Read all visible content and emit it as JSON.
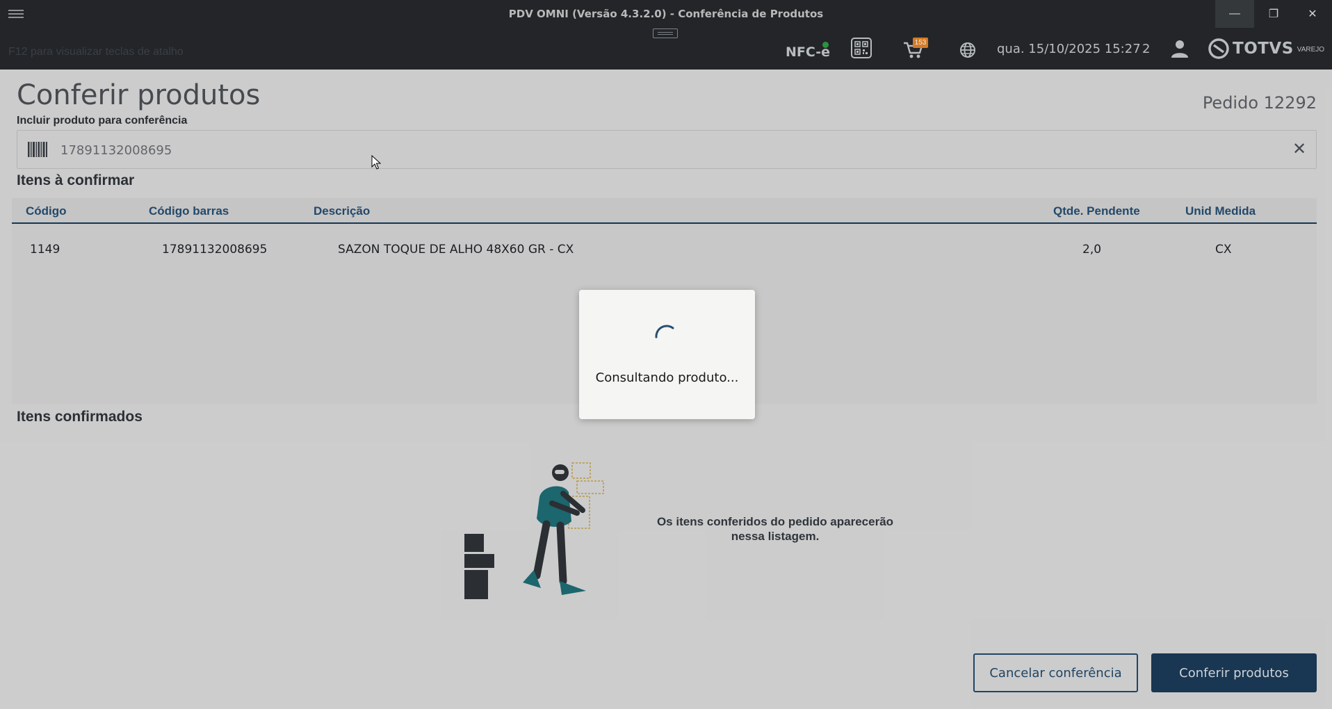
{
  "window": {
    "title": "PDV OMNI (Versão 4.3.2.0) - Conferência de Produtos",
    "minimize_glyph": "—",
    "restore_glyph": "❐",
    "close_glyph": "✕"
  },
  "header": {
    "shortcut_hint": "F12 para visualizar teclas de atalho",
    "nfce_label": "NFC-e",
    "cart_badge": "153",
    "datetime": "qua. 15/10/2025 15:27",
    "user_count": "2",
    "brand_name": "TOTVS",
    "brand_sub": "VAREJO"
  },
  "page": {
    "title": "Conferir produtos",
    "order_number": "Pedido 12292",
    "include_label": "Incluir produto para conferência",
    "search_value": "17891132008695",
    "clear_glyph": "✕"
  },
  "pending": {
    "title": "Itens à confirmar",
    "columns": [
      "Código",
      "Código barras",
      "Descrição",
      "Qtde. Pendente",
      "Unid Medida"
    ],
    "rows": [
      {
        "code": "1149",
        "barcode": "17891132008695",
        "description": "SAZON TOQUE DE ALHO 48X60 GR - CX",
        "qty": "2,0",
        "unit": "CX"
      }
    ]
  },
  "confirmed": {
    "title": "Itens confirmados",
    "empty_line1": "Os itens conferidos do pedido aparecerão",
    "empty_line2": "nessa listagem."
  },
  "actions": {
    "cancel_label": "Cancelar conferência",
    "confirm_label": "Conferir produtos"
  },
  "loading": {
    "message": "Consultando produto..."
  },
  "colors": {
    "accent": "#1c3b59",
    "header_bg": "#26292d",
    "badge": "#e8862a",
    "status_online": "#2ea043"
  },
  "icons": [
    "menu-icon",
    "drag-handle-icon",
    "qr-code-icon",
    "cart-icon",
    "globe-icon",
    "user-icon",
    "totvs-logo-icon",
    "barcode-icon",
    "close-icon",
    "spinner-icon",
    "cursor-icon"
  ]
}
